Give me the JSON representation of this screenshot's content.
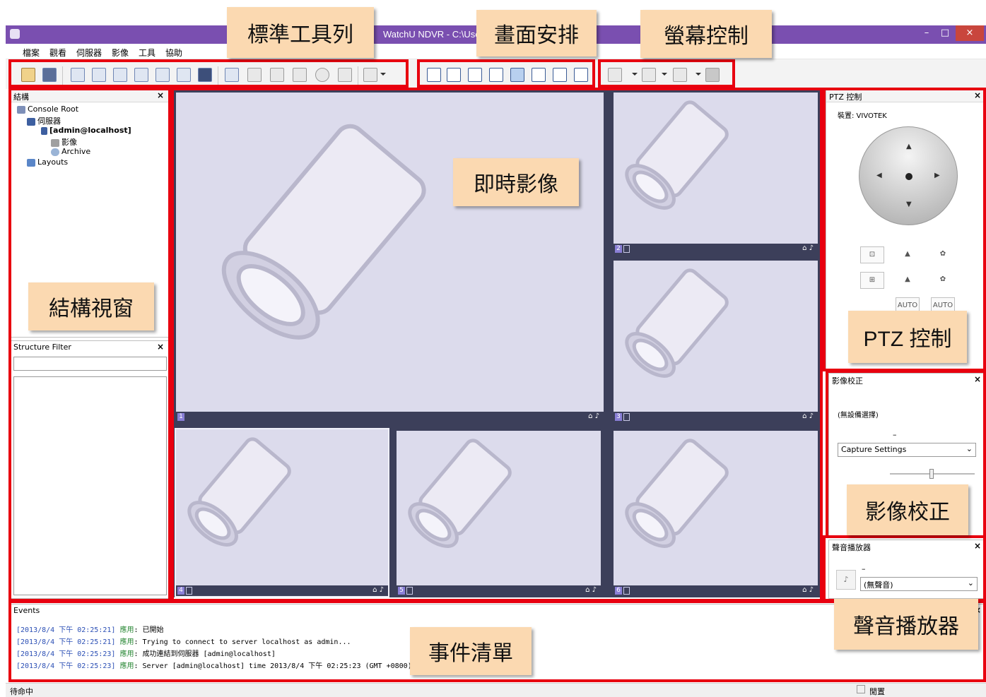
{
  "window": {
    "title": "WatchU NDVR - C:\\Users\\...\\WatchU.lnk",
    "min_label": "–",
    "max_label": "□",
    "close_label": "×"
  },
  "menu": [
    "檔案",
    "觀看",
    "伺服器",
    "影像",
    "工具",
    "協助"
  ],
  "callouts": {
    "standard_toolbar": "標準工具列",
    "layout": "畫面安排",
    "screen_control": "螢幕控制",
    "live_video": "即時影像",
    "structure_window": "結構視窗",
    "ptz_control": "PTZ 控制",
    "image_correction": "影像校正",
    "audio_player": "聲音播放器",
    "event_list": "事件清單"
  },
  "structure": {
    "header": "結構",
    "close": "×",
    "tree": [
      {
        "label": "Console Root",
        "level": 0,
        "icon": "console-icon"
      },
      {
        "label": "伺服器",
        "level": 1,
        "icon": "servers-icon"
      },
      {
        "label": "[admin@localhost]",
        "level": 2,
        "icon": "server-icon",
        "bold": true
      },
      {
        "label": "影像",
        "level": 3,
        "icon": "video-icon"
      },
      {
        "label": "Archive",
        "level": 3,
        "icon": "archive-icon"
      },
      {
        "label": "Layouts",
        "level": 0,
        "icon": "layouts-icon"
      }
    ]
  },
  "structure_filter": {
    "header": "Structure Filter",
    "close": "×",
    "input_value": ""
  },
  "video_cells": [
    {
      "num": "1",
      "label": "camera-1"
    },
    {
      "num": "2",
      "label": "camera-2"
    },
    {
      "num": "3",
      "label": "camera-3"
    },
    {
      "num": "4",
      "label": "camera-4"
    },
    {
      "num": "5",
      "label": "camera-5"
    },
    {
      "num": "6",
      "label": "camera-6"
    }
  ],
  "ptz": {
    "header": "PTZ 控制",
    "close": "×",
    "device_label": "裝置: VIVOTEK",
    "auto1": "AUTO",
    "auto2": "AUTO"
  },
  "image_correction": {
    "header": "影像校正",
    "close": "×",
    "no_device": "(無設備選擇)",
    "dash": "–",
    "capture_select": "Capture Settings"
  },
  "audio": {
    "header": "聲音播放器",
    "close": "×",
    "dash": "–",
    "select_value": "(無聲音)"
  },
  "events": {
    "header": "Events",
    "close": "×",
    "entries": [
      {
        "ts": "[2013/8/4 下午 02:25:21]",
        "src": "應用",
        "msg": ": 已開始"
      },
      {
        "ts": "[2013/8/4 下午 02:25:21]",
        "src": "應用",
        "msg": ": Trying to connect to server localhost as admin..."
      },
      {
        "ts": "[2013/8/4 下午 02:25:23]",
        "src": "應用",
        "msg": ": 成功連結到伺服器 [admin@localhost]"
      },
      {
        "ts": "[2013/8/4 下午 02:25:23]",
        "src": "應用",
        "msg": ": Server [admin@localhost] time 2013/8/4 下午 02:25:23 (GMT +0800)"
      }
    ]
  },
  "status": {
    "left": "待命中",
    "right": "閒置"
  },
  "colors": {
    "title_bar": "#7a4fb0",
    "annotation_red": "#e8000f",
    "callout_bg": "#fbd9b1",
    "video_bg": "#3c3f5a",
    "cell_bg": "#dcdbec"
  }
}
